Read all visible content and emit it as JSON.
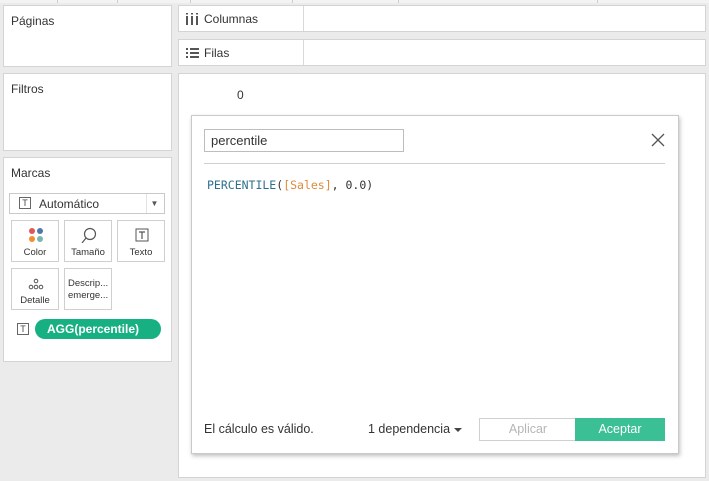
{
  "left_panel": {
    "pages_title": "Páginas",
    "filters_title": "Filtros",
    "marks": {
      "title": "Marcas",
      "mark_type_icon": "T",
      "mark_type": "Automático",
      "buttons": [
        {
          "label": "Color",
          "icon": "color-dots-icon"
        },
        {
          "label": "Tamaño",
          "icon": "size-lasso-icon"
        },
        {
          "label": "Texto",
          "icon": "text-t-icon"
        },
        {
          "label": "Detalle",
          "icon": "detail-dots-icon"
        },
        {
          "label": "Descrip... emerge...",
          "icon": "none"
        }
      ],
      "pill_icon": "T",
      "pill_label": "AGG(percentile)",
      "pill_color": "#17b082"
    }
  },
  "shelves": {
    "columns_label": "Columnas",
    "rows_label": "Filas"
  },
  "view": {
    "value": "0"
  },
  "dialog": {
    "name_value": "percentile",
    "formula": {
      "function": "PERCENTILE",
      "open_paren": "(",
      "field": "[Sales]",
      "rest": ", 0.0)"
    },
    "status_text": "El cálculo es válido.",
    "dependencies_label": "1 dependencia",
    "apply_label": "Aplicar",
    "ok_label": "Aceptar",
    "ok_color": "#3bbf95",
    "function_color": "#2e6f8e",
    "field_color": "#e08a3c"
  }
}
